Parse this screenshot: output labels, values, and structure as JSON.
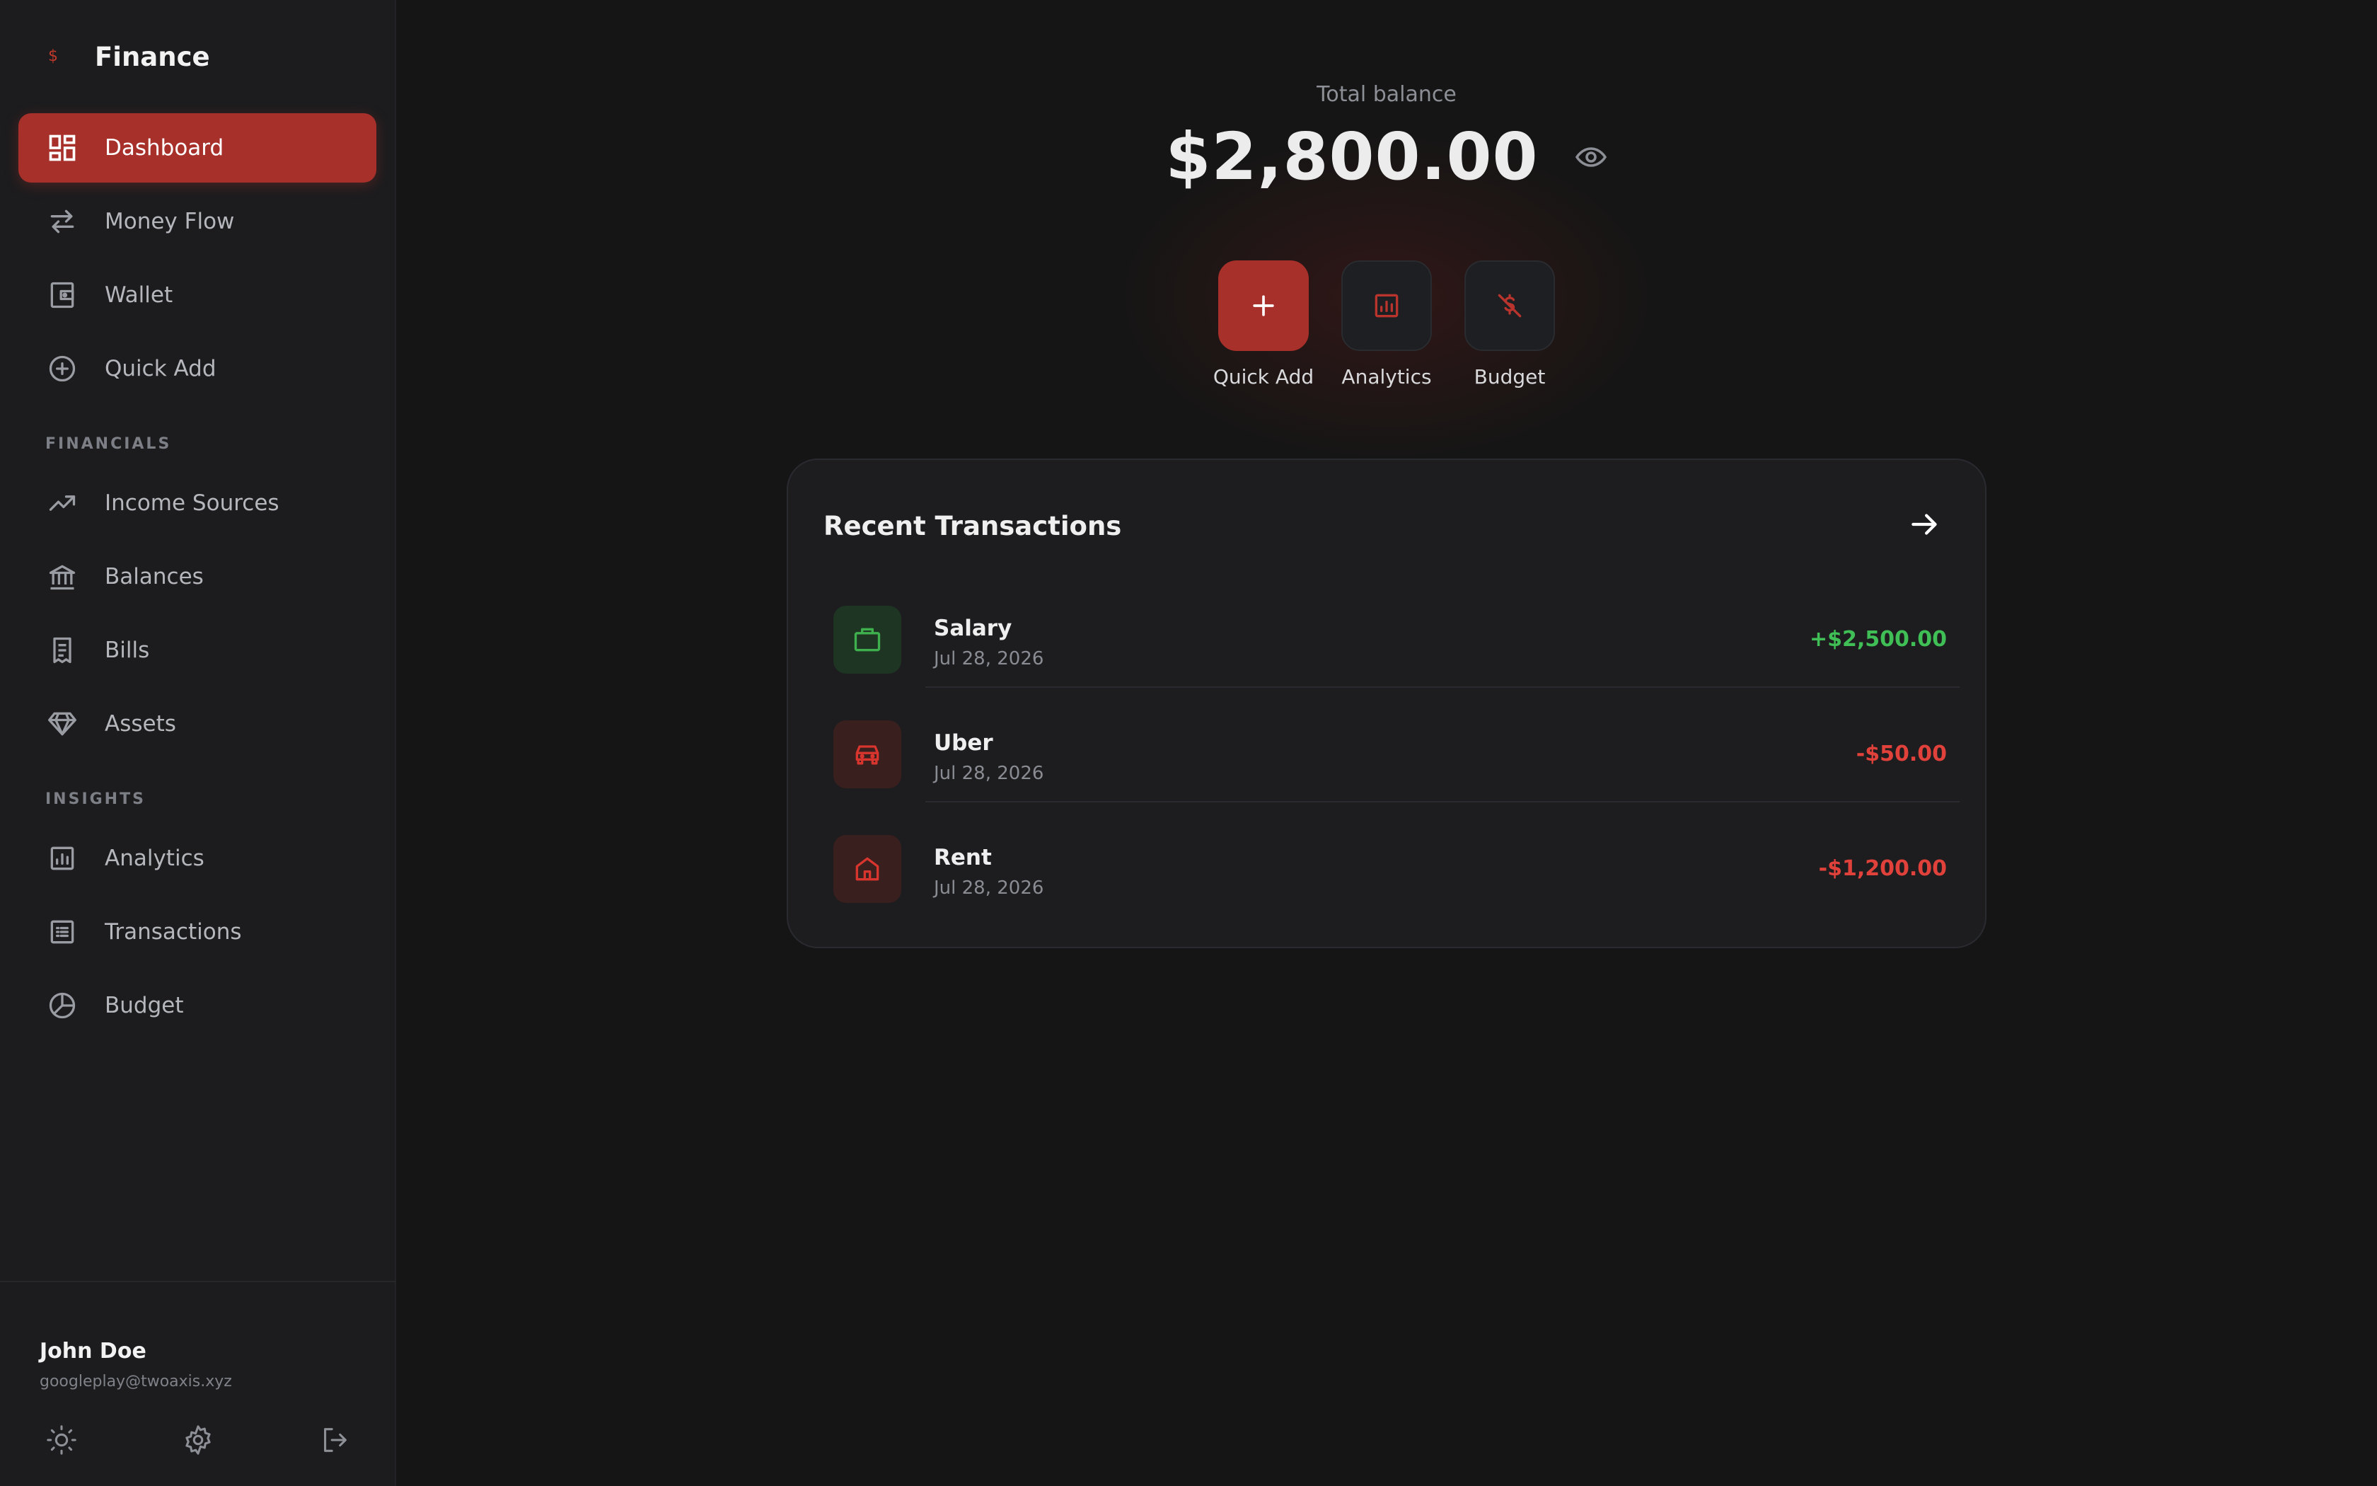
{
  "app": {
    "name": "Finance"
  },
  "nav": {
    "main": [
      {
        "label": "Dashboard",
        "icon": "dashboard-icon",
        "active": true
      },
      {
        "label": "Money Flow",
        "icon": "transfer-arrows-icon"
      },
      {
        "label": "Wallet",
        "icon": "wallet-icon"
      },
      {
        "label": "Quick Add",
        "icon": "plus-circle-icon"
      }
    ],
    "financials_label": "FINANCIALS",
    "financials": [
      {
        "label": "Income Sources",
        "icon": "trending-up-icon"
      },
      {
        "label": "Balances",
        "icon": "bank-icon"
      },
      {
        "label": "Bills",
        "icon": "receipt-icon"
      },
      {
        "label": "Assets",
        "icon": "diamond-icon"
      }
    ],
    "insights_label": "INSIGHTS",
    "insights": [
      {
        "label": "Analytics",
        "icon": "bar-chart-icon"
      },
      {
        "label": "Transactions",
        "icon": "list-icon"
      },
      {
        "label": "Budget",
        "icon": "pie-chart-icon"
      }
    ]
  },
  "user": {
    "name": "John Doe",
    "email": "googleplay@twoaxis.xyz"
  },
  "balance": {
    "label": "Total balance",
    "value": "$2,800.00"
  },
  "actions": [
    {
      "label": "Quick Add",
      "icon": "plus-icon"
    },
    {
      "label": "Analytics",
      "icon": "bar-chart-icon"
    },
    {
      "label": "Budget",
      "icon": "no-money-icon"
    }
  ],
  "recent": {
    "title": "Recent Transactions",
    "items": [
      {
        "name": "Salary",
        "date": "Jul 28, 2026",
        "amount": "+$2,500.00",
        "type": "income",
        "icon": "briefcase-icon"
      },
      {
        "name": "Uber",
        "date": "Jul 28, 2026",
        "amount": "-$50.00",
        "type": "expense",
        "icon": "car-icon"
      },
      {
        "name": "Rent",
        "date": "Jul 28, 2026",
        "amount": "-$1,200.00",
        "type": "expense",
        "icon": "home-icon"
      }
    ]
  },
  "colors": {
    "accent": "#a8302a",
    "income": "#3fbf55",
    "expense": "#e0413a",
    "background": "#151515",
    "sidebar": "#1c1c1e"
  }
}
